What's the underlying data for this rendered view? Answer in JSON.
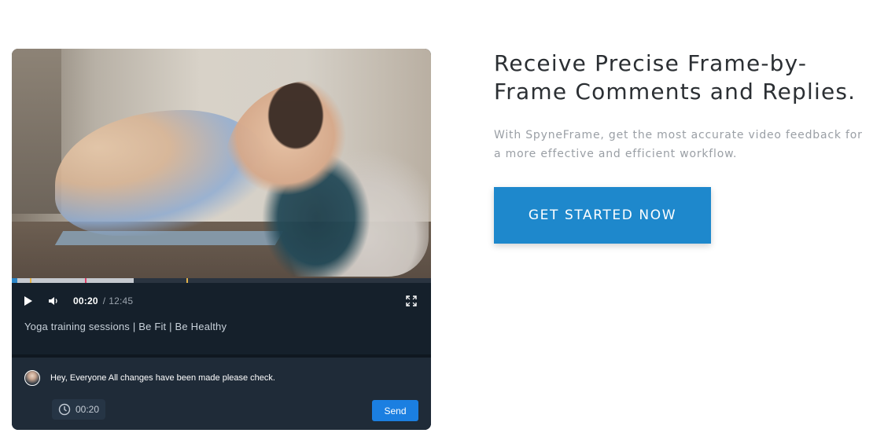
{
  "player": {
    "title": "Yoga training sessions | Be Fit | Be Healthy",
    "current_time": "00:20",
    "separator": "/",
    "total_time": "12:45",
    "progress": 0.29,
    "progress_markers": [
      {
        "position": 0.043,
        "color": "#e3b34b"
      },
      {
        "position": 0.175,
        "color": "#e0416a"
      },
      {
        "position": 0.417,
        "color": "#e3b34b"
      }
    ],
    "icons": {
      "play": "play-icon",
      "volume": "volume-icon",
      "fullscreen": "fullscreen-icon"
    },
    "colors": {
      "progress_fill": "#c5c9cf",
      "buffer_start": "#2b86c8",
      "panel_bg": "#15202b"
    }
  },
  "comment": {
    "text": "Hey, Everyone All changes have been made please check.",
    "timestamp": "00:20",
    "send_label": "Send",
    "icons": {
      "avatar": "avatar-icon",
      "clock": "clock-icon"
    }
  },
  "hero": {
    "headline": "Receive Precise Frame-by-Frame Comments and Replies.",
    "subtext": "With SpyneFrame, get the most accurate video feedback for a more effective and efficient workflow.",
    "cta_label": "GET STARTED NOW",
    "colors": {
      "cta": "#1e88cc",
      "headline": "#2b2f33",
      "subtext": "#9a9fa5"
    }
  }
}
